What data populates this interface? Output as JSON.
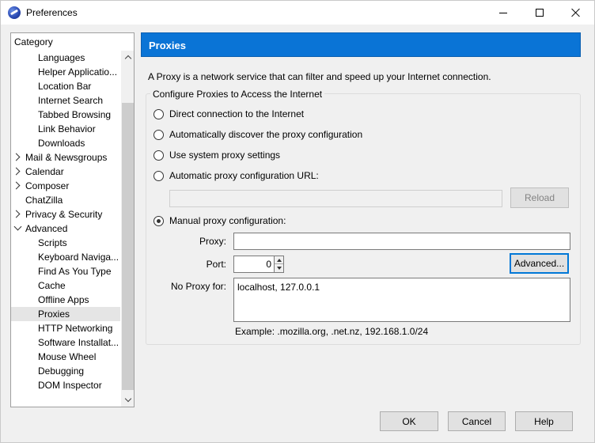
{
  "window": {
    "title": "Preferences",
    "controls": [
      "minimize",
      "maximize",
      "close"
    ]
  },
  "category": {
    "header": "Category",
    "items": [
      {
        "label": "Languages",
        "level": "child"
      },
      {
        "label": "Helper Applicatio...",
        "level": "child"
      },
      {
        "label": "Location Bar",
        "level": "child"
      },
      {
        "label": "Internet Search",
        "level": "child"
      },
      {
        "label": "Tabbed Browsing",
        "level": "child"
      },
      {
        "label": "Link Behavior",
        "level": "child"
      },
      {
        "label": "Downloads",
        "level": "child"
      },
      {
        "label": "Mail & Newsgroups",
        "level": "top",
        "twisty": "closed"
      },
      {
        "label": "Calendar",
        "level": "top",
        "twisty": "closed"
      },
      {
        "label": "Composer",
        "level": "top",
        "twisty": "closed"
      },
      {
        "label": "ChatZilla",
        "level": "leaf-top"
      },
      {
        "label": "Privacy & Security",
        "level": "top",
        "twisty": "closed"
      },
      {
        "label": "Advanced",
        "level": "top",
        "twisty": "open"
      },
      {
        "label": "Scripts",
        "level": "child"
      },
      {
        "label": "Keyboard Naviga...",
        "level": "child"
      },
      {
        "label": "Find As You Type",
        "level": "child"
      },
      {
        "label": "Cache",
        "level": "child"
      },
      {
        "label": "Offline Apps",
        "level": "child"
      },
      {
        "label": "Proxies",
        "level": "child",
        "selected": true
      },
      {
        "label": "HTTP Networking",
        "level": "child"
      },
      {
        "label": "Software Installat...",
        "level": "child"
      },
      {
        "label": "Mouse Wheel",
        "level": "child"
      },
      {
        "label": "Debugging",
        "level": "child"
      },
      {
        "label": "DOM Inspector",
        "level": "child"
      }
    ]
  },
  "panel": {
    "title": "Proxies",
    "description": "A Proxy is a network service that can filter and speed up your Internet connection.",
    "group_label": "Configure Proxies to Access the Internet",
    "options": {
      "direct": "Direct connection to the Internet",
      "autodiscover": "Automatically discover the proxy configuration",
      "system": "Use system proxy settings",
      "auto_url": "Automatic proxy configuration URL:",
      "manual": "Manual proxy configuration:"
    },
    "selected_option": "manual",
    "auto_url_value": "",
    "reload_label": "Reload",
    "proxy_label": "Proxy:",
    "proxy_value": "",
    "port_label": "Port:",
    "port_value": "0",
    "advanced_label": "Advanced...",
    "no_proxy_label": "No Proxy for:",
    "no_proxy_value": "localhost, 127.0.0.1",
    "example": "Example: .mozilla.org, .net.nz, 192.168.1.0/24"
  },
  "footer": {
    "ok_label": "OK",
    "cancel_label": "Cancel",
    "help_label": "Help"
  },
  "colors": {
    "header_bg": "#0a74d6",
    "focus_border": "#0078d7"
  }
}
